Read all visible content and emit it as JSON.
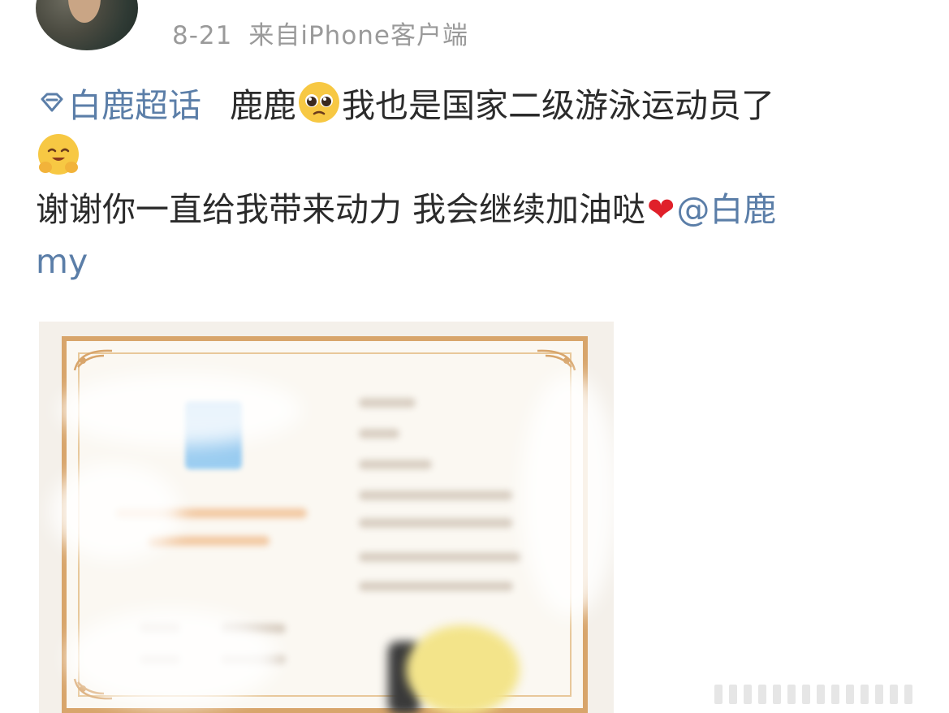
{
  "post": {
    "date": "8-21",
    "source": "来自iPhone客户端",
    "topic_name": "白鹿超话",
    "line1_a": "鹿鹿",
    "line1_b": "我也是国家二级游泳运动员了",
    "line3": "谢谢你一直给我带来动力 我会继续加油哒",
    "heart": "❤",
    "mention_a": "@白鹿",
    "mention_b": "my"
  },
  "icons": {
    "topic": "diamond-topic-icon",
    "emoji1": "pleading-face-emoji",
    "emoji2": "hugging-face-emoji"
  },
  "colors": {
    "link": "#5b7ea8",
    "text": "#2b2b2b",
    "meta": "#9a9a9a",
    "heart": "#e0202a"
  },
  "image": {
    "description_alt": "blurred swimming athlete certificate"
  }
}
